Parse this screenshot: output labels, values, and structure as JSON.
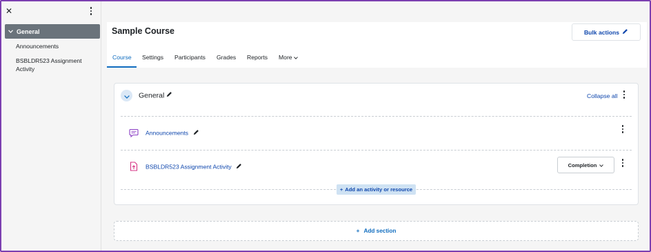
{
  "drawer": {
    "close_icon": "close-icon",
    "menu_icon": "kebab-icon",
    "section": {
      "label": "General",
      "icon": "chevron-down-icon"
    },
    "items": [
      {
        "label": "Announcements"
      },
      {
        "label_line1": "BSBLDR523 Assignment",
        "label_line2": "Activity"
      }
    ]
  },
  "header": {
    "title": "Sample Course",
    "bulk_actions_label": "Bulk actions",
    "bulk_actions_icon": "pencil-icon"
  },
  "tabs": [
    {
      "label": "Course",
      "active": true
    },
    {
      "label": "Settings"
    },
    {
      "label": "Participants"
    },
    {
      "label": "Grades"
    },
    {
      "label": "Reports"
    },
    {
      "label": "More"
    }
  ],
  "section": {
    "title": "General",
    "collapse_all_label": "Collapse all",
    "activities": [
      {
        "name": "Announcements",
        "icon": "forum-icon",
        "icon_color": "#8a3ec4"
      },
      {
        "name": "BSBLDR523 Assignment Activity",
        "icon": "assignment-upload-icon",
        "icon_color": "#d63384",
        "completion_label": "Completion"
      }
    ],
    "add_activity_label": "Add an activity or resource"
  },
  "add_section_label": "Add section",
  "colors": {
    "accent": "#0f6cbf",
    "link": "#0f47ad",
    "frame_border": "#7b3fb0",
    "drawer_active": "#6a737b"
  }
}
